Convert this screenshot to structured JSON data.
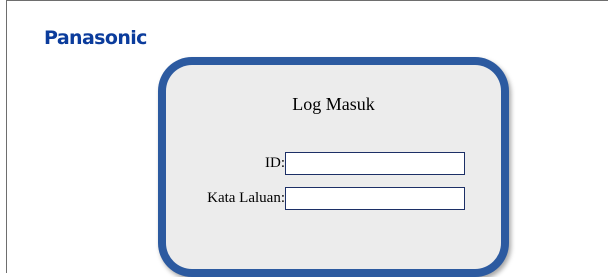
{
  "header": {
    "logo_text": "Panasonic"
  },
  "login": {
    "title": "Log Masuk",
    "id_label": "ID:",
    "id_value": "",
    "password_label": "Kata Laluan:",
    "password_value": ""
  },
  "colors": {
    "logo": "#0b3c9c",
    "panel_border": "#2c5aa0",
    "panel_fill": "#ececec"
  }
}
